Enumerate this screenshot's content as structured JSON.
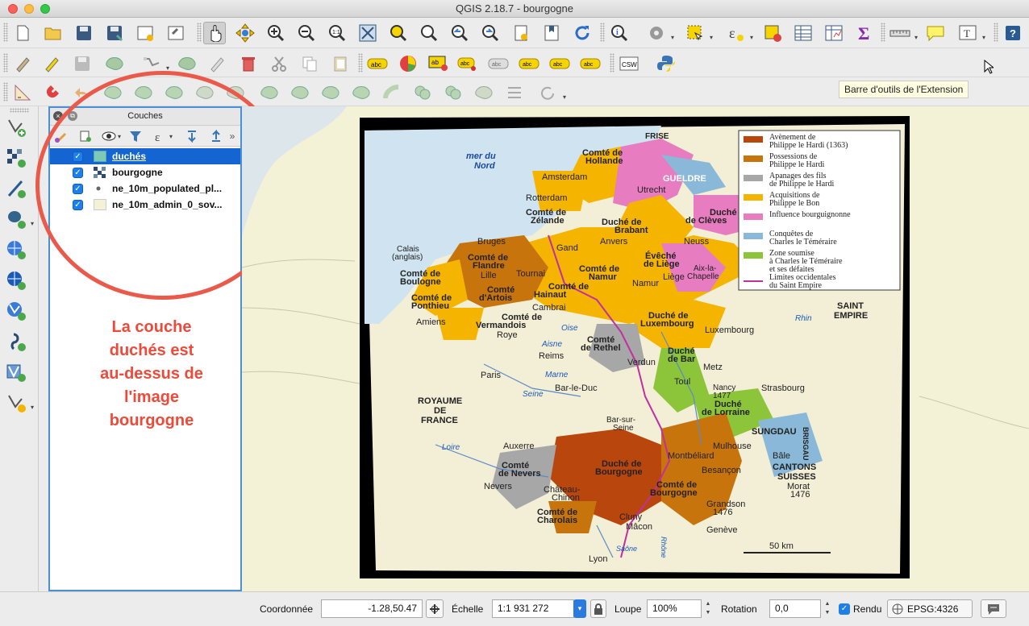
{
  "window": {
    "title": "QGIS 2.18.7 - bourgogne"
  },
  "toolbar1": {
    "icons": [
      "new-project",
      "open-project",
      "save-project",
      "save-as",
      "new-print-composer",
      "composer-manager",
      "pan",
      "pan-to-selection",
      "zoom-in",
      "zoom-out",
      "zoom-actual",
      "zoom-full",
      "zoom-to-selection",
      "zoom-to-layer",
      "zoom-last",
      "zoom-next",
      "new-bookmark",
      "show-bookmarks",
      "refresh",
      "identify",
      "run-action",
      "select-features",
      "deselect",
      "open-attribute-table",
      "open-field-calculator",
      "statistical-summary",
      "measure",
      "map-tips",
      "text-annotation",
      "help"
    ]
  },
  "tooltip": {
    "text": "Barre d'outils de l'Extension"
  },
  "layers_panel": {
    "title": "Couches",
    "layers": [
      {
        "name": "duchés",
        "checked": true,
        "selected": true,
        "symbol": "polygon-teal"
      },
      {
        "name": "bourgogne",
        "checked": true,
        "selected": false,
        "symbol": "raster"
      },
      {
        "name": "ne_10m_populated_pl...",
        "checked": true,
        "selected": false,
        "symbol": "point"
      },
      {
        "name": "ne_10m_admin_0_sov...",
        "checked": true,
        "selected": false,
        "symbol": "polygon-cream"
      }
    ]
  },
  "annotation": {
    "line1": "La couche",
    "line2": "duchés est",
    "line3": "au-dessus de",
    "line4": "l'image",
    "line5": "bourgogne"
  },
  "map": {
    "regions": {
      "frise": "FRISE",
      "mer_du_nord_1": "mer du",
      "mer_du_nord_2": "Nord",
      "comte_hollande_1": "Comté de",
      "comte_hollande_2": "Hollande",
      "amsterdam": "Amsterdam",
      "gueldre": "GUELDRE",
      "utrecht": "Utrecht",
      "rotterdam": "Rotterdam",
      "comte_zelande_1": "Comté de",
      "comte_zelande_2": "Zélande",
      "duche_cleves_1": "Duché",
      "duche_cleves_2": "de Clèves",
      "duche_brabant_1": "Duché de",
      "duche_brabant_2": "Brabant",
      "bruges": "Bruges",
      "gand": "Gand",
      "anvers": "Anvers",
      "neuss": "Neuss",
      "calais_1": "Calais",
      "calais_2": "(anglais)",
      "comte_flandre_1": "Comté de",
      "comte_flandre_2": "Flandre",
      "lille": "Lille",
      "tournai": "Tournai",
      "comte_namur_1": "Comté de",
      "comte_namur_2": "Namur",
      "eveche_liege_1": "Évêché",
      "eveche_liege_2": "de Liège",
      "aix_1": "Aix-la-",
      "aix_2": "Chapelle",
      "liege": "Liège",
      "namur": "Namur",
      "comte_boulogne_1": "Comté de",
      "comte_boulogne_2": "Boulogne",
      "comte_artois_1": "Comté",
      "comte_artois_2": "d'Artois",
      "comte_hainaut_1": "Comté de",
      "comte_hainaut_2": "Hainaut",
      "comte_ponthieu_1": "Comté de",
      "comte_ponthieu_2": "Ponthieu",
      "cambrai": "Cambrai",
      "amiens": "Amiens",
      "comte_vermandois_1": "Comté de",
      "comte_vermandois_2": "Vermandois",
      "roye": "Roye",
      "oise": "Oise",
      "duche_luxembourg_1": "Duché de",
      "duche_luxembourg_2": "Luxembourg",
      "luxembourg": "Luxembourg",
      "saint_empire_1": "SAINT",
      "saint_empire_2": "EMPIRE",
      "rhin": "Rhin",
      "comte_rethel_1": "Comté",
      "comte_rethel_2": "de Rethel",
      "aisne": "Aisne",
      "reims": "Reims",
      "verdun": "Verdun",
      "duche_bar_1": "Duché",
      "duche_bar_2": "de Bar",
      "metz": "Metz",
      "paris": "Paris",
      "marne": "Marne",
      "toul": "Toul",
      "nancy_1": "Nancy",
      "nancy_2": "1477",
      "strasbourg": "Strasbourg",
      "bar_le_duc": "Bar-le-Duc",
      "seine": "Seine",
      "duche_lorraine_1": "Duché",
      "duche_lorraine_2": "de Lorraine",
      "royaume_1": "ROYAUME",
      "royaume_2": "DE",
      "royaume_3": "FRANCE",
      "bar_sur_seine_1": "Bar-sur-",
      "bar_sur_seine_2": "Seine",
      "sungdau": "SUNGDAU",
      "brisgau": "BRISGAU",
      "loire": "Loire",
      "auxerre": "Auxerre",
      "mulhouse": "Mulhouse",
      "bale": "Bâle",
      "duche_bourgogne_1": "Duché de",
      "duche_bourgogne_2": "Bourgogne",
      "montbeliard": "Montbéliard",
      "comte_nevers_1": "Comté",
      "comte_nevers_2": "de Nevers",
      "besancon": "Besançon",
      "cantons_1": "CANTONS",
      "cantons_2": "SUISSES",
      "nevers": "Nevers",
      "chateau_chinon_1": "Château-",
      "chateau_chinon_2": "Chinon",
      "comte_bourgogne_1": "Comté de",
      "comte_bourgogne_2": "Bourgogne",
      "morat_1": "Morat",
      "morat_2": "1476",
      "grandson_1": "Grandson",
      "grandson_2": "1476",
      "comte_charolais_1": "Comté de",
      "comte_charolais_2": "Charolais",
      "cluny": "Cluny",
      "macon": "Mâcon",
      "geneve": "Genève",
      "saone": "Saône",
      "rhone": "Rhône",
      "lyon": "Lyon",
      "scale": "50 km"
    },
    "legend": [
      {
        "color": "#b8460d",
        "l1": "Avènement de",
        "l2": "Philippe le Hardi (1363)"
      },
      {
        "color": "#c8740d",
        "l1": "Possessions de",
        "l2": "Philippe le Hardi"
      },
      {
        "color": "#a7a7a7",
        "l1": "Apanages des fils",
        "l2": "de Philippe le Hardi"
      },
      {
        "color": "#f5b400",
        "l1": "Acquisitions de",
        "l2": "Philippe le Bon"
      },
      {
        "color": "#e87cc0",
        "l1": "Influence bourguignonne",
        "l2": ""
      },
      {
        "color": "#8ab8d8",
        "l1": "Conquêtes de",
        "l2": "Charles le Téméraire"
      },
      {
        "color": "#8cc43a",
        "l1": "Zone soumise",
        "l2": "à Charles le Téméraire"
      },
      {
        "color": "#c030a0",
        "l1": "Limites occidentales",
        "l2": "du Saint Empire"
      }
    ],
    "legend_extra": "et ses défaites"
  },
  "status": {
    "coord_label": "Coordonnée",
    "coord_value": "-1.28,50.47",
    "scale_label": "Échelle",
    "scale_value": "1:1 931 272",
    "magnifier_label": "Loupe",
    "magnifier_value": "100%",
    "rotation_label": "Rotation",
    "rotation_value": "0,0",
    "render_label": "Rendu",
    "render_checked": true,
    "crs": "EPSG:4326"
  }
}
